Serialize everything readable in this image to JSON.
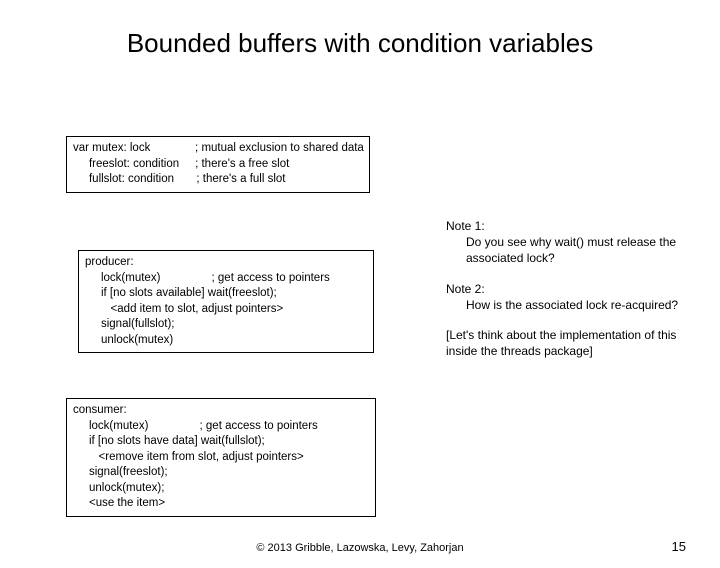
{
  "title": "Bounded buffers with condition variables",
  "box1": "var mutex: lock              ; mutual exclusion to shared data\n     freeslot: condition     ; there's a free slot\n     fullslot: condition       ; there's a full slot",
  "box2": "producer:\n     lock(mutex)                ; get access to pointers\n     if [no slots available] wait(freeslot);\n        <add item to slot, adjust pointers>\n     signal(fullslot);\n     unlock(mutex)",
  "box3": "consumer:\n     lock(mutex)                ; get access to pointers\n     if [no slots have data] wait(fullslot);\n        <remove item from slot, adjust pointers>\n     signal(freeslot);\n     unlock(mutex);\n     <use the item>",
  "note1_head": "Note 1:",
  "note1_body": "Do you see why wait() must release the associated lock?",
  "note2_head": "Note 2:",
  "note2_body": "How is the associated lock re-acquired?",
  "note3": "[Let's think about the implementation of this inside the threads package]",
  "copyright": "© 2013 Gribble, Lazowska, Levy, Zahorjan",
  "pagenum": "15"
}
